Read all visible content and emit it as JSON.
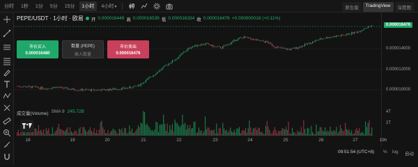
{
  "topbar": {
    "timeframes": [
      "分时",
      "1秒",
      "1分",
      "5分",
      "15分",
      "1小时",
      "4小时"
    ],
    "active_timeframe": "1小时",
    "views": [
      "原生版",
      "TradingView",
      "深度图"
    ],
    "active_view": "TradingView"
  },
  "symbol": {
    "pair": "PEPE/USDT · 1小时 · 欧易",
    "open_label": "开",
    "open": "0.000016449",
    "high_label": "高",
    "high": "0.000016539",
    "low_label": "低",
    "low": "0.000016334",
    "close_label": "收",
    "close": "0.000016476",
    "change": "+0.000000018 (+0.11%)"
  },
  "trade": {
    "buy_label": "市价买入",
    "buy_price": "0.000016480",
    "qty_label": "数量 (PEPE)",
    "qty_placeholder": "输入数量",
    "sell_label": "市价卖出",
    "sell_price": "0.000016476"
  },
  "price_axis": {
    "ticks": [
      "0.000014000",
      "0.000012000",
      "0.000010000"
    ],
    "current": "0.000016476",
    "volume_ticks": [
      "4T",
      "2T"
    ]
  },
  "volume": {
    "label": "成交量(Volume)",
    "sma": "SMA 9",
    "value": "245.72B"
  },
  "dates": [
    "18",
    "19",
    "20",
    "21",
    "22",
    "23",
    "24",
    "25",
    "26",
    "27",
    "19h"
  ],
  "footer": {
    "clock": "09:51:54 (UTC+8)",
    "pct": "%",
    "log": "log",
    "auto": "自动"
  },
  "colors": {
    "up": "#1fb36a",
    "down": "#c9405b",
    "background": "#131313"
  },
  "chart_data": {
    "type": "candlestick",
    "x_range": [
      "17",
      "27 19h"
    ],
    "y_range": [
      8.8e-06,
      1.68e-05
    ],
    "close_series": [
      1e-05,
      9.95e-06,
      9.9e-06,
      9.82e-06,
      9.75e-06,
      9.9e-06,
      9.8e-06,
      9.68e-06,
      9.62e-06,
      9.6e-06,
      9.58e-06,
      9.6e-06,
      9.62e-06,
      9.7e-06,
      9.75e-06,
      9.85e-06,
      1.005e-05,
      1.06e-05,
      1.12e-05,
      1.18e-05,
      1.24e-05,
      1.29e-05,
      1.36e-05,
      1.42e-05,
      1.44e-05,
      1.45e-05,
      1.42e-05,
      1.41e-05,
      1.45e-05,
      1.5e-05,
      1.52e-05,
      1.5e-05,
      1.48e-05,
      1.47e-05,
      1.42e-05,
      1.4e-05,
      1.39e-05,
      1.41e-05,
      1.44e-05,
      1.47e-05,
      1.5e-05,
      1.52e-05,
      1.53e-05,
      1.54e-05,
      1.56e-05,
      1.58e-05,
      1.62e-05,
      1.647e-05
    ]
  }
}
